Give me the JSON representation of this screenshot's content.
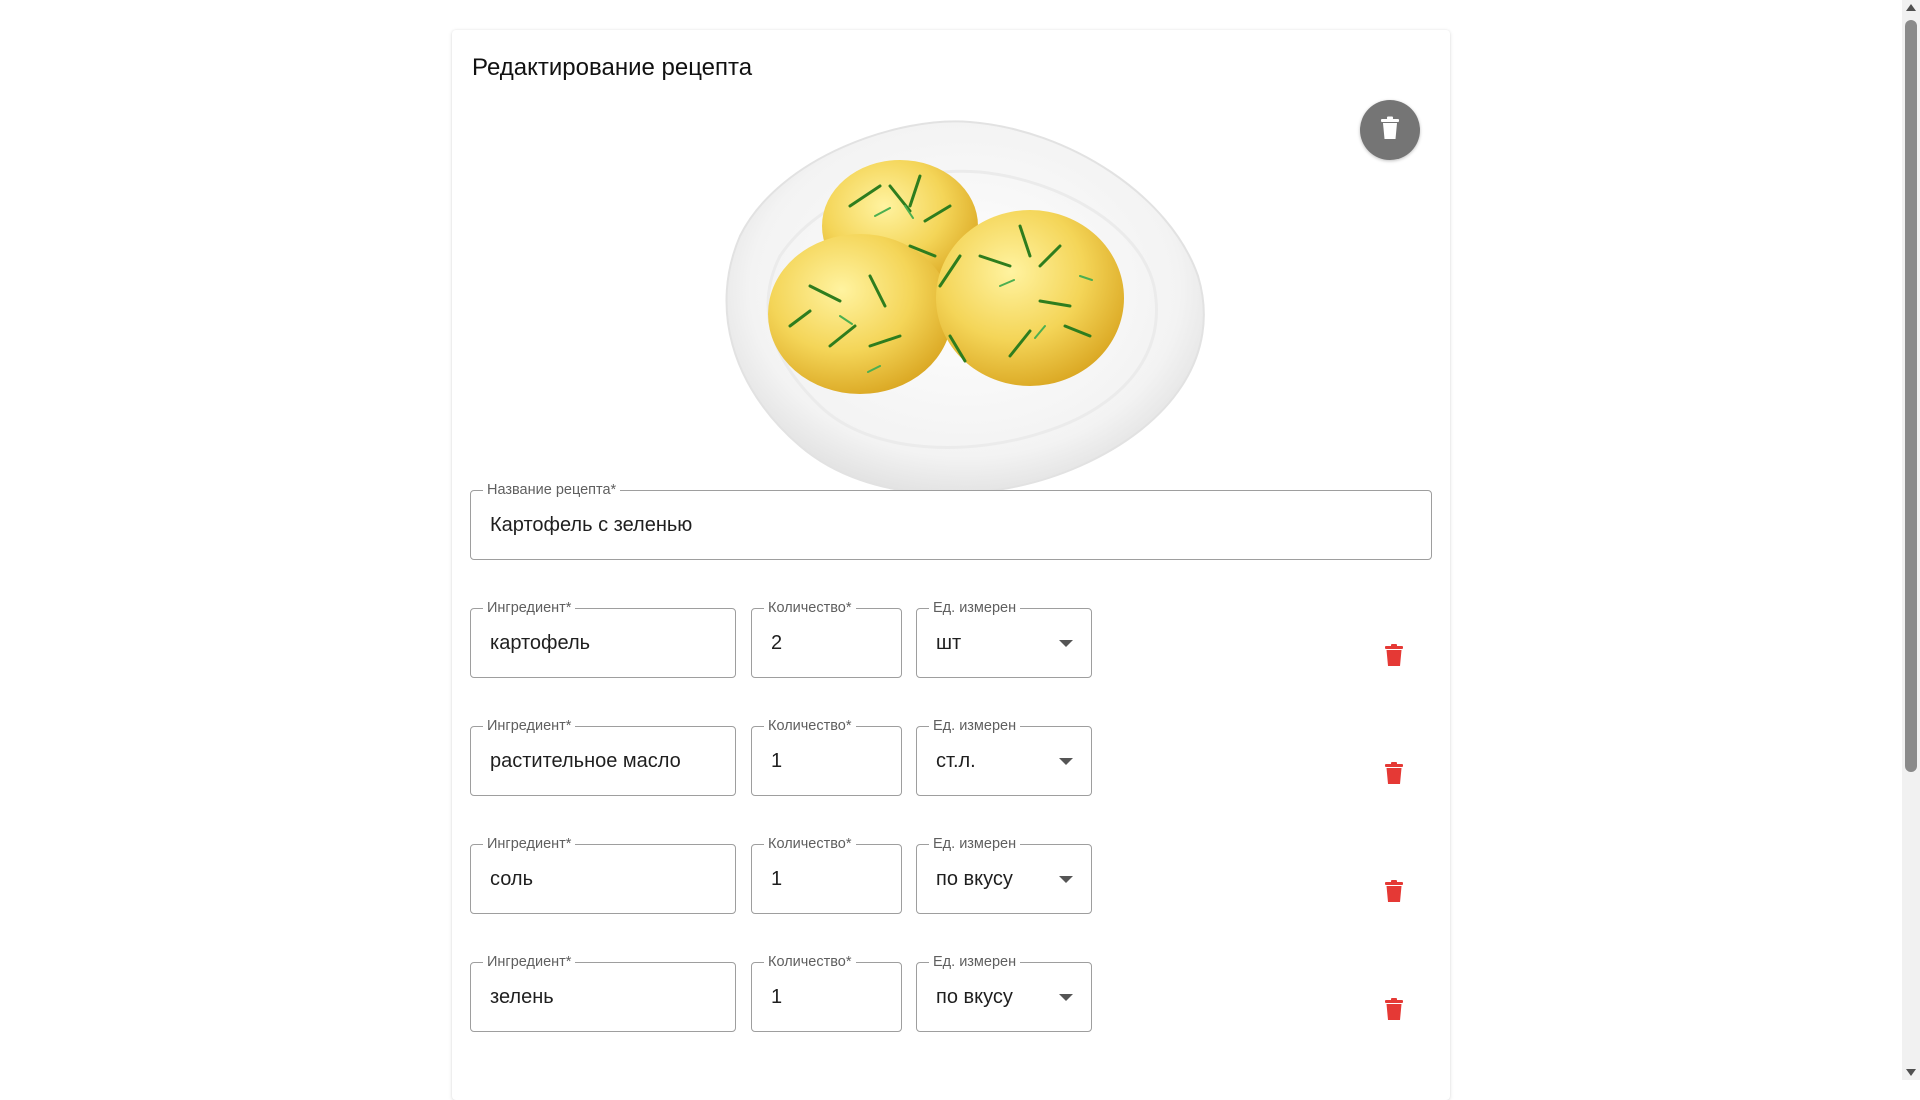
{
  "page": {
    "title": "Редактирование рецепта"
  },
  "recipe": {
    "image_alt": "boiled-potatoes-with-dill-photo",
    "name_label": "Название рецепта*",
    "name_value": "Картофель с зеленью"
  },
  "ingredient_labels": {
    "name": "Ингредиент*",
    "quantity": "Количество*",
    "unit": "Ед. измерен"
  },
  "ingredients": [
    {
      "name": "картофель",
      "quantity": "2",
      "unit": "шт"
    },
    {
      "name": "растительное масло",
      "quantity": "1",
      "unit": "ст.л."
    },
    {
      "name": "соль",
      "quantity": "1",
      "unit": "по вкусу"
    },
    {
      "name": "зелень",
      "quantity": "1",
      "unit": "по вкусу"
    }
  ],
  "icons": {
    "delete_photo": "trash-icon",
    "delete_ingredient": "trash-icon"
  },
  "colors": {
    "delete_ingredient": "#e53935",
    "delete_photo_bg": "#757575"
  }
}
